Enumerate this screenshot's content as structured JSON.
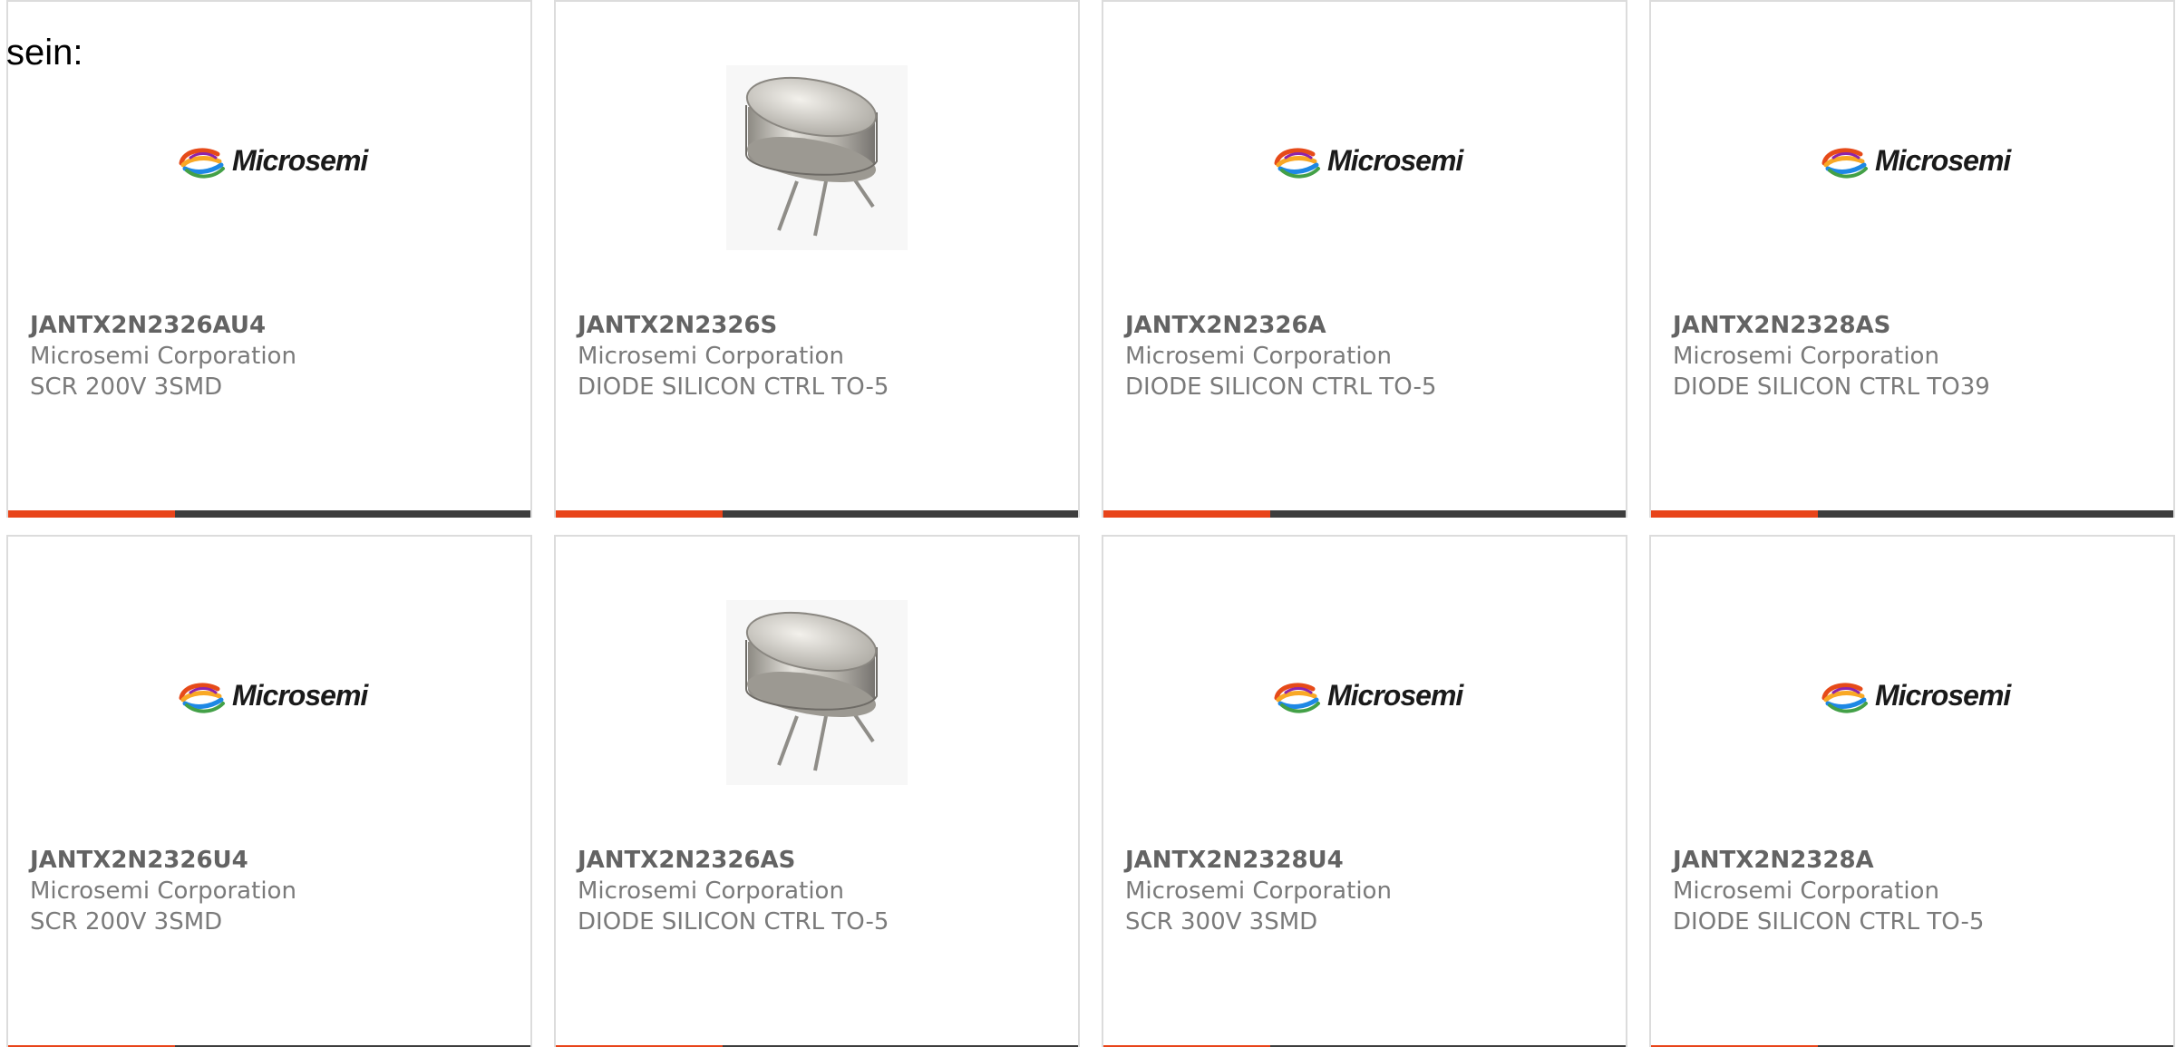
{
  "intro_text": "sein:",
  "brand": {
    "logo_text": "Microsemi",
    "bar_accent": "#e8441a",
    "bar_base": "#3d3d3d",
    "logo_colors": [
      "#e64a19",
      "#f9a825",
      "#1e88e5",
      "#43a047",
      "#8e24aa"
    ]
  },
  "cards": [
    {
      "part": "JANTX2N2326AU4",
      "manufacturer": "Microsemi Corporation",
      "description": "SCR 200V 3SMD",
      "image": "microsemi-logo",
      "progress": 0.32
    },
    {
      "part": "JANTX2N2326S",
      "manufacturer": "Microsemi Corporation",
      "description": "DIODE SILICON CTRL TO-5",
      "image": "to5-transistor-can",
      "progress": 0.32
    },
    {
      "part": "JANTX2N2326A",
      "manufacturer": "Microsemi Corporation",
      "description": "DIODE SILICON CTRL TO-5",
      "image": "microsemi-logo",
      "progress": 0.32
    },
    {
      "part": "JANTX2N2328AS",
      "manufacturer": "Microsemi Corporation",
      "description": "DIODE SILICON CTRL TO39",
      "image": "microsemi-logo",
      "progress": 0.32
    },
    {
      "part": "JANTX2N2326U4",
      "manufacturer": "Microsemi Corporation",
      "description": "SCR 200V 3SMD",
      "image": "microsemi-logo",
      "progress": 0.32
    },
    {
      "part": "JANTX2N2326AS",
      "manufacturer": "Microsemi Corporation",
      "description": "DIODE SILICON CTRL TO-5",
      "image": "to5-transistor-can",
      "progress": 0.32
    },
    {
      "part": "JANTX2N2328U4",
      "manufacturer": "Microsemi Corporation",
      "description": "SCR 300V 3SMD",
      "image": "microsemi-logo",
      "progress": 0.32
    },
    {
      "part": "JANTX2N2328A",
      "manufacturer": "Microsemi Corporation",
      "description": "DIODE SILICON CTRL TO-5",
      "image": "microsemi-logo",
      "progress": 0.32
    }
  ]
}
